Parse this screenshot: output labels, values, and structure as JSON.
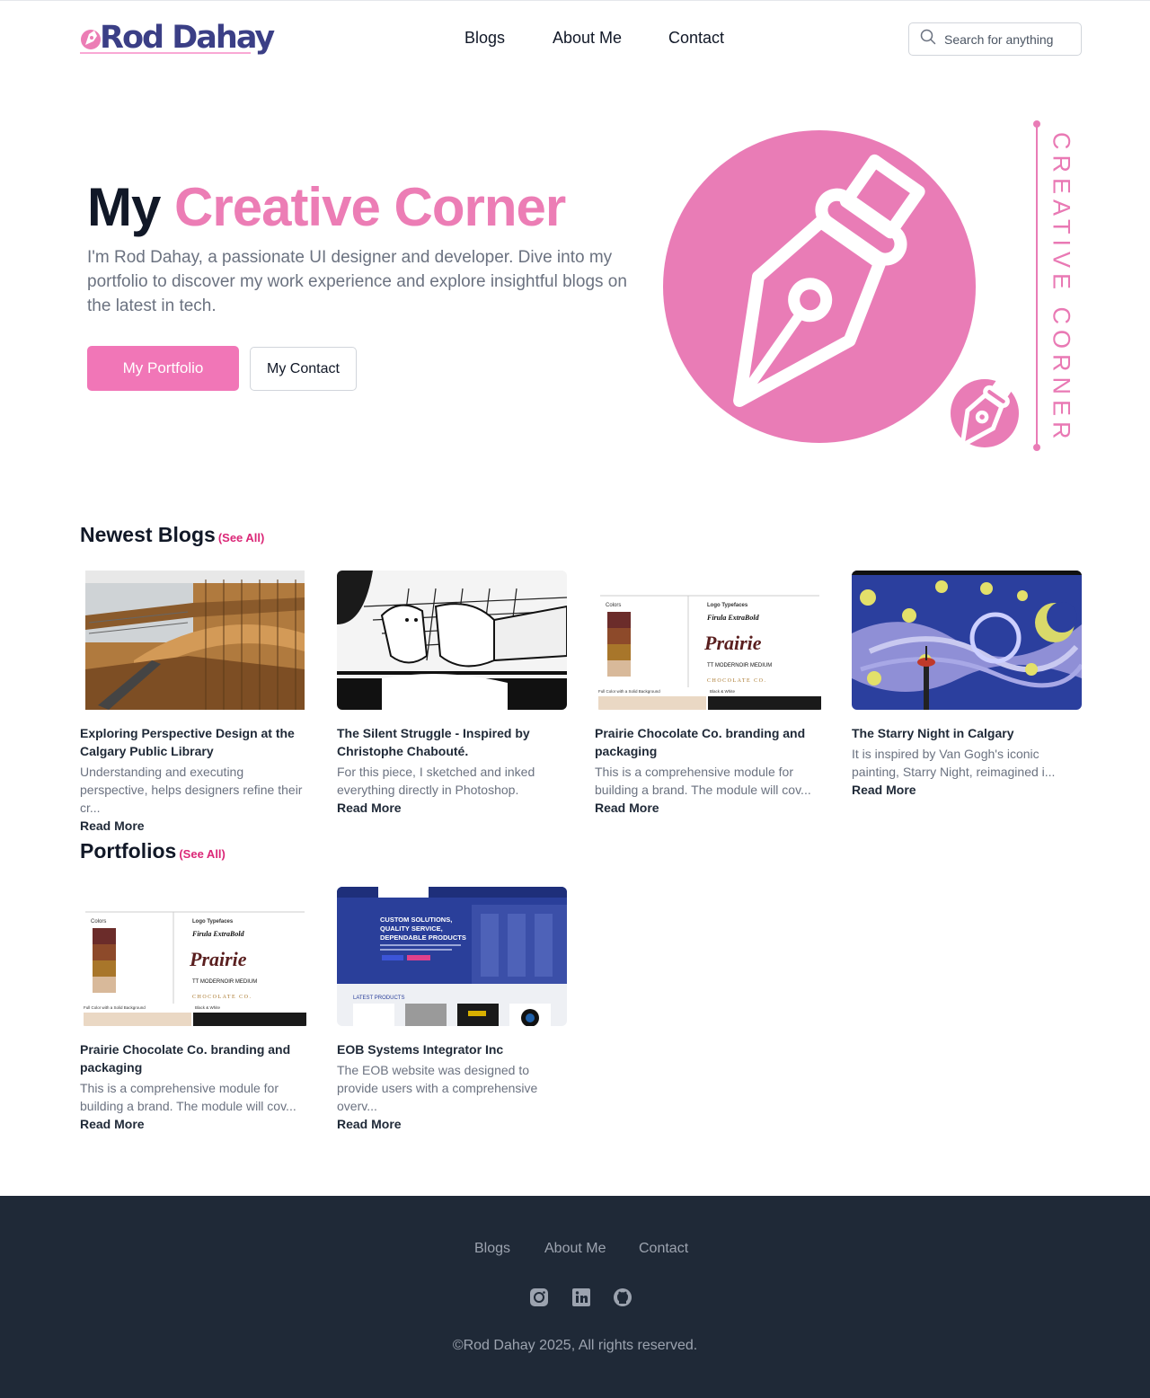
{
  "brand": {
    "name": "Rod Dahay"
  },
  "nav": {
    "items": [
      "Blogs",
      "About Me",
      "Contact"
    ]
  },
  "search": {
    "placeholder": "Search for anything"
  },
  "hero": {
    "title_dark": "My",
    "title_accent": "Creative Corner",
    "description": "I'm Rod Dahay, a passionate UI designer and developer. Dive into my portfolio to discover my work experience and explore insightful blogs on the latest in tech.",
    "primary_button": "My Portfolio",
    "secondary_button": "My Contact",
    "side_text": "CREATIVE CORNER"
  },
  "blogs": {
    "title": "Newest Blogs",
    "see_all": "(See All)",
    "items": [
      {
        "title": "Exploring Perspective Design at the Calgary Public Library",
        "excerpt": "Understanding and executing perspective, helps designers refine their cr...",
        "more": "Read More"
      },
      {
        "title": "The Silent Struggle - Inspired by Christophe Chabouté.",
        "excerpt": "For this piece, I sketched and inked everything directly in Photoshop.",
        "more": "Read More"
      },
      {
        "title": "Prairie Chocolate Co. branding and packaging",
        "excerpt": "This is a comprehensive module for building a brand. The module will cov...",
        "more": "Read More"
      },
      {
        "title": "The Starry Night in Calgary",
        "excerpt": "It is inspired by Van Gogh's iconic painting, Starry Night, reimagined i...",
        "more": "Read More"
      }
    ]
  },
  "portfolios": {
    "title": "Portfolios",
    "see_all": "(See All)",
    "items": [
      {
        "title": "Prairie Chocolate Co. branding and packaging",
        "excerpt": "This is a comprehensive module for building a brand. The module will cov...",
        "more": "Read More"
      },
      {
        "title": "EOB Systems Integrator Inc",
        "excerpt": "The EOB website was designed to provide users with a comprehensive overv...",
        "more": "Read More"
      }
    ]
  },
  "thumbs": {
    "prairie": {
      "colors_label": "Colors",
      "typefaces_label": "Logo Typefaces",
      "font1": "Firula ExtraBold",
      "font2": "TT MODERNOIR MEDIUM",
      "logo": "Prairie",
      "tagline": "CHOCOLATE CO.",
      "bg1": "Full Color with a Solid Background",
      "bg2": "Black & White"
    },
    "eob": {
      "headline1": "CUSTOM SOLUTIONS,",
      "headline2": "QUALITY SERVICE,",
      "headline3": "DEPENDABLE PRODUCTS",
      "latest": "LATEST PRODUCTS"
    }
  },
  "footer": {
    "nav": [
      "Blogs",
      "About Me",
      "Contact"
    ],
    "social": [
      "instagram-icon",
      "linkedin-icon",
      "github-icon"
    ],
    "copyright": "©Rod Dahay 2025, All rights reserved."
  },
  "colors": {
    "accent": "#f176b7",
    "brand": "#3b3f86",
    "footer_bg": "#1f2937"
  }
}
